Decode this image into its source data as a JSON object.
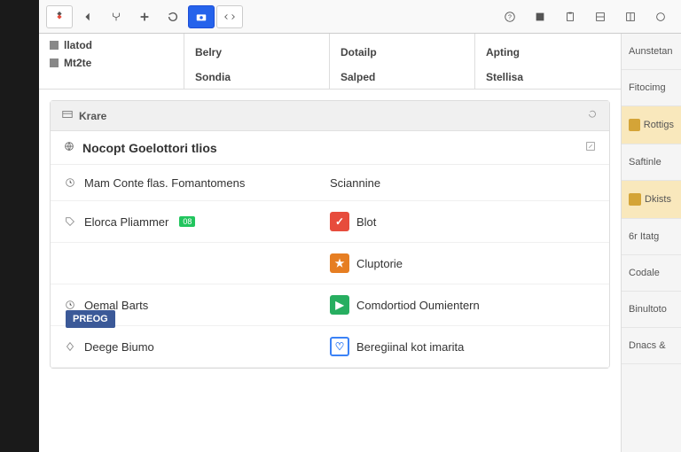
{
  "toolbar": {
    "left_icons": [
      "app",
      "back",
      "fork",
      "add",
      "refresh",
      "camera",
      "code"
    ],
    "right_icons": [
      "help",
      "panel",
      "clipboard",
      "view1",
      "view2",
      "circle"
    ]
  },
  "tabs": {
    "col1_a": "llatod",
    "col1_b": "Mt2te",
    "col2_a": "Belry",
    "col2_b": "Sondia",
    "col3_a": "Dotailp",
    "col3_b": "Salped",
    "col4_a": "Apting",
    "col4_b": "Stellisa"
  },
  "card": {
    "title": "Krare",
    "section_title": "Nocopt Goelottori tlios"
  },
  "rows": [
    {
      "left": "Mam Conte flas. Fomantomens",
      "right": "Sciannine",
      "right_color": ""
    },
    {
      "left": "Elorca Pliammer",
      "left_badge": "08",
      "right": "Blot",
      "right_color": "red"
    },
    {
      "left": "",
      "right": "Cluptorie",
      "right_color": "orange"
    },
    {
      "left": "Oemal Barts",
      "right": "Comdortiod Oumientern",
      "right_color": "green"
    },
    {
      "left": "Deege Biumo",
      "right": "Beregiinal kot imarita",
      "right_color": "blue-outline"
    }
  ],
  "floating": "PREOG",
  "sidebar": [
    {
      "label": "Aunstetan"
    },
    {
      "label": "Fitocimg"
    },
    {
      "label": "Rottigs",
      "highlight": true,
      "icon": true
    },
    {
      "label": "Saftinle"
    },
    {
      "label": "Dkists",
      "highlight": true,
      "icon": true
    },
    {
      "label": "6r Itatg"
    },
    {
      "label": "Codale"
    },
    {
      "label": "Binultoto"
    },
    {
      "label": "Dnacs &"
    }
  ]
}
